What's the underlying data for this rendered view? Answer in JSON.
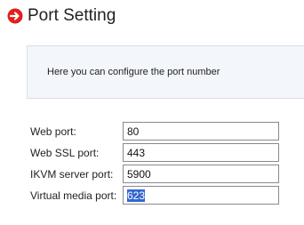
{
  "header": {
    "icon": "arrow-right-circle-icon",
    "icon_color": "#e02020",
    "title": "Port Setting"
  },
  "info": {
    "text": "Here you can configure the port number"
  },
  "form": {
    "fields": [
      {
        "label": "Web port:",
        "value": "80"
      },
      {
        "label": "Web SSL port:",
        "value": "443"
      },
      {
        "label": "IKVM server port:",
        "value": "5900"
      },
      {
        "label": "Virtual media port:",
        "value": "623"
      }
    ]
  }
}
